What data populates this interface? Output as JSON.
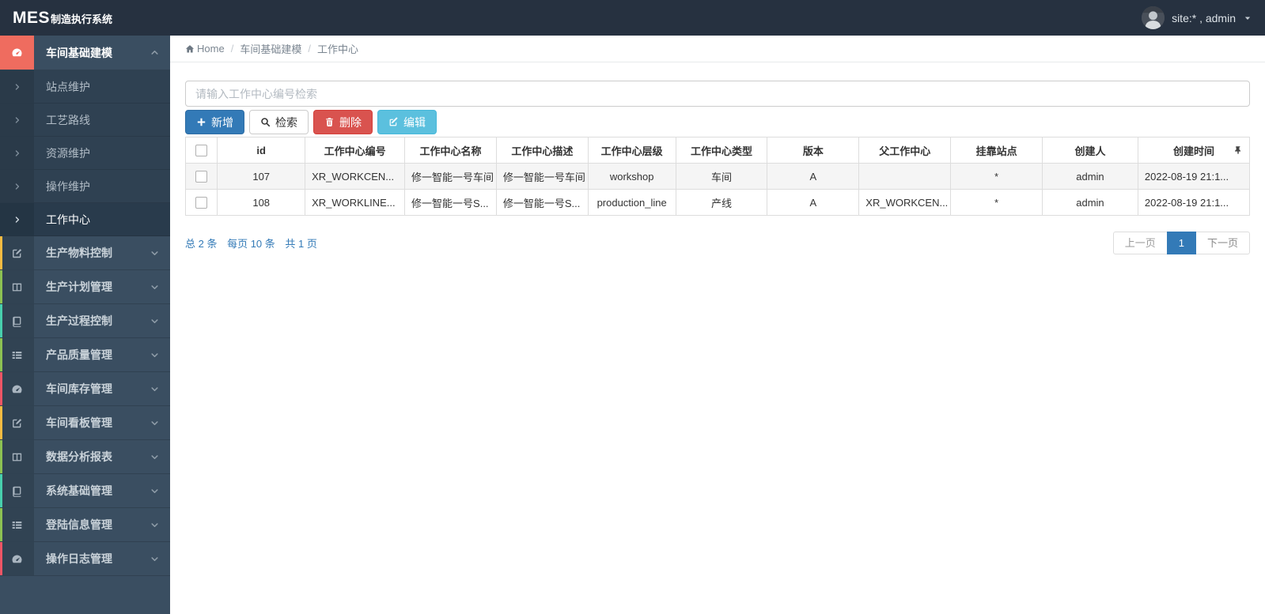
{
  "navbar": {
    "brand_primary": "MES",
    "brand_secondary": "制造执行系统",
    "user_label": "site:* , admin",
    "user_caret_icon": "caret-down"
  },
  "breadcrumb": {
    "items": [
      {
        "label": "Home",
        "icon": "home",
        "link": true
      },
      {
        "label": "车间基础建模",
        "link": true
      },
      {
        "label": "工作中心",
        "link": false
      }
    ]
  },
  "sidebar": {
    "items": [
      {
        "label": "车间基础建模",
        "icon": "dashboard",
        "expanded": true,
        "icon_bg": "#ef6c5f",
        "chevron": "chevron-up",
        "children": [
          {
            "label": "站点维护",
            "active": false
          },
          {
            "label": "工艺路线",
            "active": false
          },
          {
            "label": "资源维护",
            "active": false
          },
          {
            "label": "操作维护",
            "active": false
          },
          {
            "label": "工作中心",
            "active": true
          }
        ]
      },
      {
        "label": "生产物料控制",
        "icon": "pencil",
        "stripe": "#f6bb42",
        "chevron": "chevron-down"
      },
      {
        "label": "生产计划管理",
        "icon": "columns",
        "stripe": "#8cc152",
        "chevron": "chevron-down"
      },
      {
        "label": "生产过程控制",
        "icon": "book",
        "stripe": "#48cfad",
        "chevron": "chevron-down"
      },
      {
        "label": "产品质量管理",
        "icon": "list",
        "stripe": "#8cc152",
        "chevron": "chevron-down"
      },
      {
        "label": "车间库存管理",
        "icon": "dashboard",
        "stripe": "#ed5565",
        "chevron": "chevron-down"
      },
      {
        "label": "车间看板管理",
        "icon": "pencil",
        "stripe": "#f6bb42",
        "chevron": "chevron-down"
      },
      {
        "label": "数据分析报表",
        "icon": "columns",
        "stripe": "#8cc152",
        "chevron": "chevron-down"
      },
      {
        "label": "系统基础管理",
        "icon": "book",
        "stripe": "#48cfad",
        "chevron": "chevron-down"
      },
      {
        "label": "登陆信息管理",
        "icon": "list",
        "stripe": "#8cc152",
        "chevron": "chevron-down"
      },
      {
        "label": "操作日志管理",
        "icon": "dashboard",
        "stripe": "#ed5565",
        "chevron": "chevron-down"
      }
    ]
  },
  "search": {
    "placeholder": "请输入工作中心编号检索",
    "value": ""
  },
  "toolbar": {
    "buttons": [
      {
        "name": "add",
        "label": "新增",
        "icon": "plus",
        "style": "primary"
      },
      {
        "name": "search",
        "label": "检索",
        "icon": "search",
        "style": "default"
      },
      {
        "name": "delete",
        "label": "删除",
        "icon": "trash",
        "style": "danger"
      },
      {
        "name": "edit",
        "label": "编辑",
        "icon": "edit",
        "style": "info"
      }
    ]
  },
  "table": {
    "columns": [
      "id",
      "工作中心编号",
      "工作中心名称",
      "工作中心描述",
      "工作中心层级",
      "工作中心类型",
      "版本",
      "父工作中心",
      "挂靠站点",
      "创建人",
      "创建时间"
    ],
    "aligns": [
      "c",
      "l",
      "l",
      "l",
      "c",
      "c",
      "c",
      "l",
      "c",
      "c",
      "l"
    ],
    "pin_icon": "pin",
    "rows": [
      {
        "cells": [
          "107",
          "XR_WORKCEN...",
          "修一智能一号车间",
          "修一智能一号车间",
          "workshop",
          "车间",
          "A",
          "",
          "*",
          "admin",
          "2022-08-19 21:1..."
        ]
      },
      {
        "cells": [
          "108",
          "XR_WORKLINE...",
          "修一智能一号S...",
          "修一智能一号S...",
          "production_line",
          "产线",
          "A",
          "XR_WORKCEN...",
          "*",
          "admin",
          "2022-08-19 21:1..."
        ]
      }
    ]
  },
  "pagination": {
    "summary": [
      "总 2 条",
      "每页 10 条",
      "共 1 页"
    ],
    "prev_label": "上一页",
    "page": "1",
    "next_label": "下一页"
  },
  "colors": {
    "navbar_bg": "#263140",
    "sidebar_bg": "#3a4e61",
    "sidebar_submenu_bg": "#2f4152",
    "sidebar_active_bg": "#293b4c",
    "accent_blue": "#337ab7",
    "danger_red": "#d9534f",
    "info_cyan": "#5bc0de",
    "expanded_icon_red": "#ef6c5f",
    "stripe_yellow": "#f6bb42",
    "stripe_green": "#8cc152",
    "stripe_teal": "#48cfad",
    "stripe_red": "#ed5565"
  }
}
